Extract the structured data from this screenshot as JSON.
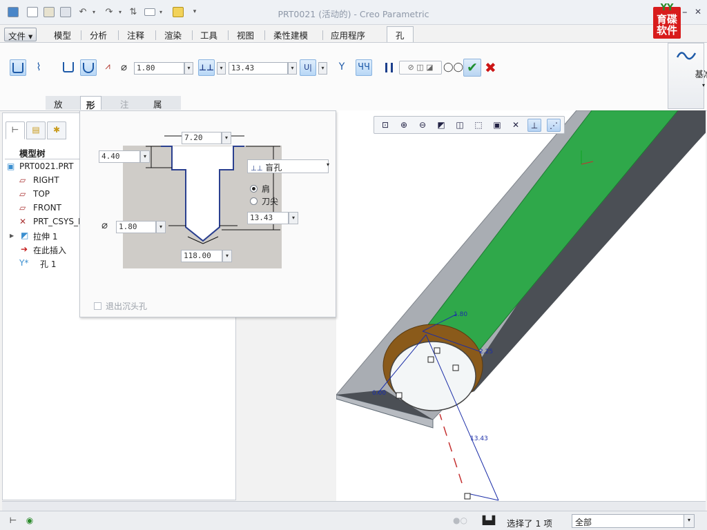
{
  "window": {
    "title": "PRT0021 (活动的) - Creo Parametric",
    "logo_text": "育碟软件",
    "logo_letters": "YY",
    "minimize": "–",
    "close": "✕"
  },
  "menu_tabs": [
    "文件",
    "模型",
    "分析",
    "注释",
    "渲染",
    "工具",
    "视图",
    "柔性建模",
    "应用程序",
    "孔"
  ],
  "ribbon": {
    "diameter_value": "1.80",
    "depth_value": "13.43",
    "datum_label": "基准",
    "subtabs": [
      "放置",
      "形状",
      "注解",
      "属性"
    ]
  },
  "model_tree": {
    "title": "模型树",
    "items": [
      {
        "label": "PRT0021.PRT",
        "icon": "part-icon"
      },
      {
        "label": "RIGHT",
        "icon": "datum-plane-icon"
      },
      {
        "label": "TOP",
        "icon": "datum-plane-icon"
      },
      {
        "label": "FRONT",
        "icon": "datum-plane-icon"
      },
      {
        "label": "PRT_CSYS_D",
        "icon": "csys-icon"
      },
      {
        "label": "拉伸 1",
        "icon": "extrude-icon"
      },
      {
        "label": "在此插入",
        "icon": "insert-arrow-icon"
      },
      {
        "label": "孔 1",
        "icon": "hole-icon"
      }
    ]
  },
  "shape_panel": {
    "top_dim": "7.20",
    "shoulder_depth": "4.40",
    "depth_type": "盲孔",
    "radio_shoulder": "肩",
    "radio_tip": "刀尖",
    "depth_value": "13.43",
    "diameter_value": "1.80",
    "drill_angle": "118.00",
    "exit_countersink": "退出沉头孔"
  },
  "viewport": {
    "dim_diameter": "1.80",
    "dim_225": "2.25",
    "dim_000": "0.00",
    "dim_depth": "13.43"
  },
  "status": {
    "selection": "选择了 1 项",
    "filter": "全部"
  },
  "colors": {
    "ribbon_icon_blue": "#1e5aa8",
    "accept_green": "#1f8f2f",
    "cancel_red": "#cc1515",
    "model_green": "#2fa84a",
    "model_grey": "#a9adb3",
    "model_dark": "#4b4f55",
    "hole_brown": "#8a5a1a",
    "dimension_blue": "#1b2ea8"
  }
}
